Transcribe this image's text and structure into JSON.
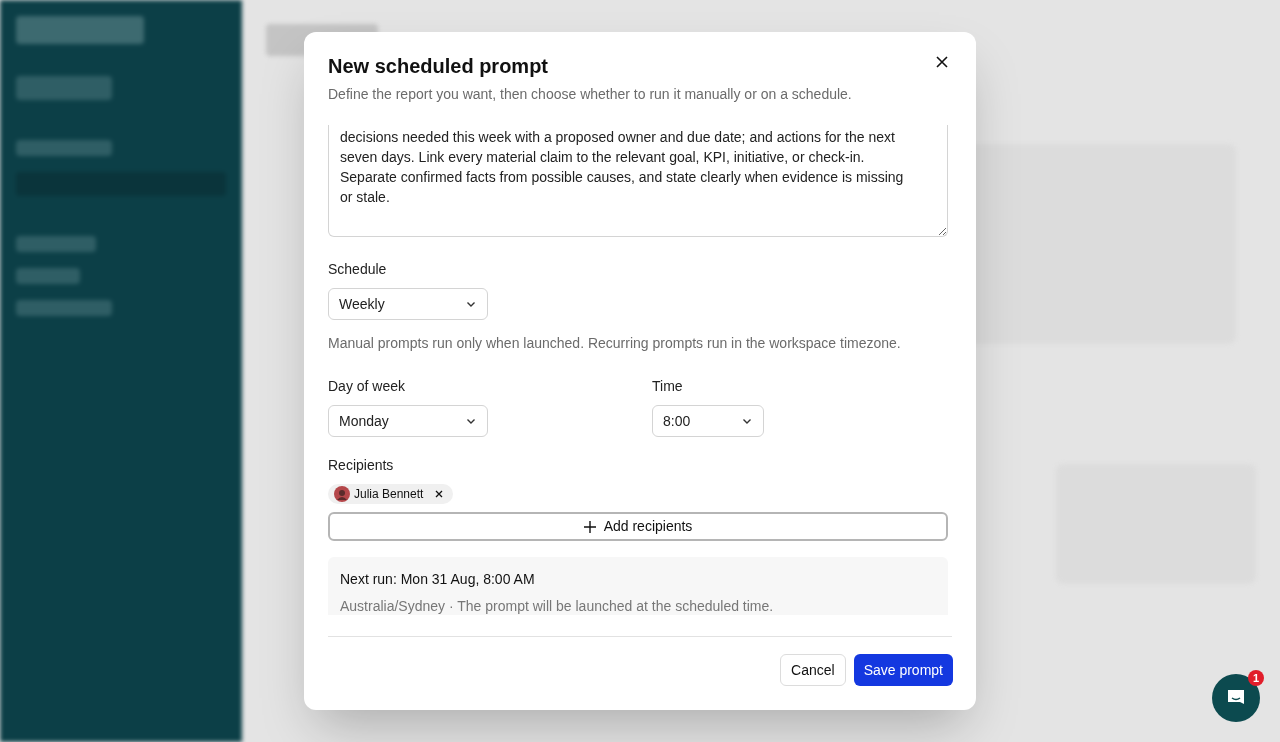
{
  "dialog": {
    "title": "New scheduled prompt",
    "subtitle": "Define the report you want, then choose whether to run it manually or on a schedule.",
    "prompt_text": "decisions needed this week with a proposed owner and due date; and actions for the next seven days. Link every material claim to the relevant goal, KPI, initiative, or check-in. Separate confirmed facts from possible causes, and state clearly when evidence is missing or stale.",
    "schedule": {
      "label": "Schedule",
      "value": "Weekly"
    },
    "schedule_help": "Manual prompts run only when launched. Recurring prompts run in the workspace timezone.",
    "day_of_week": {
      "label": "Day of week",
      "value": "Monday"
    },
    "time": {
      "label": "Time",
      "value": "8:00"
    },
    "recipients": {
      "label": "Recipients",
      "items": [
        {
          "name": "Julia Bennett"
        }
      ],
      "add_button": "Add recipients"
    },
    "next_run": {
      "title": "Next run: Mon 31 Aug, 8:00 AM",
      "detail": "Australia/Sydney · The prompt will be launched at the scheduled time."
    },
    "buttons": [
      {
        "label": "Cancel",
        "kind": "secondary"
      },
      {
        "label": "Save prompt",
        "kind": "primary"
      }
    ]
  },
  "chat_launcher": {
    "badge": "1"
  }
}
